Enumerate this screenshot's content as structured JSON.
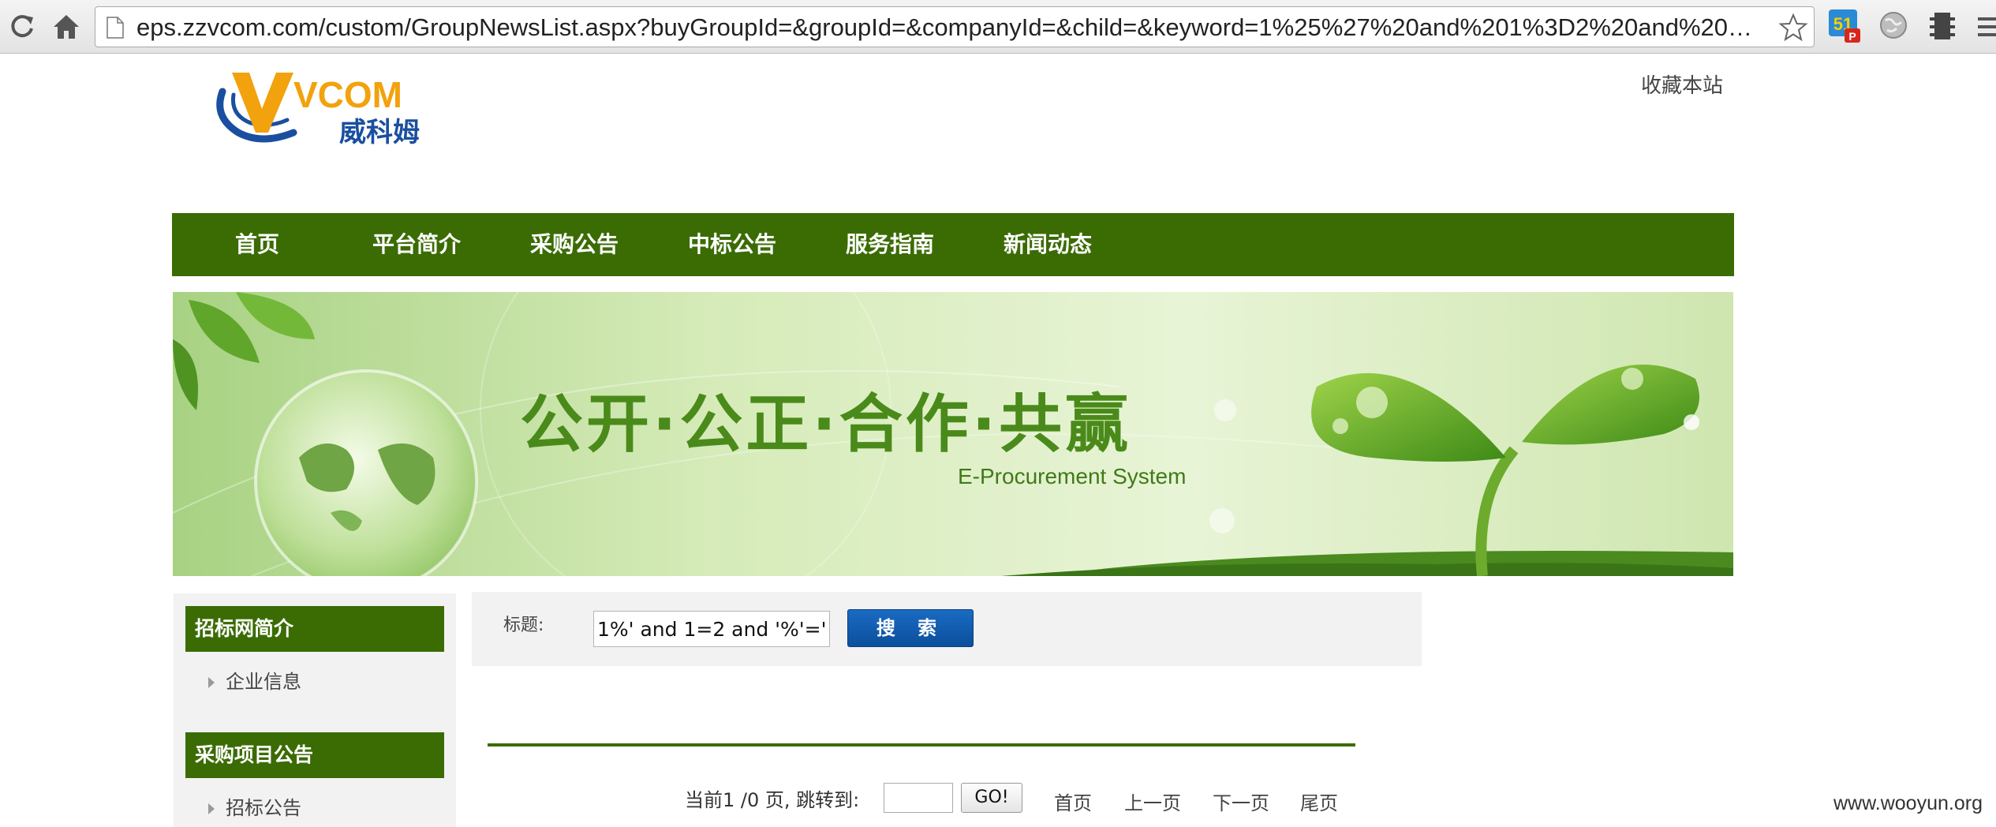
{
  "browser": {
    "url": "eps.zzvcom.com/custom/GroupNewsList.aspx?buyGroupId=&groupId=&companyId=&child=&keyword=1%25%27%20and%201%3D2%20and%20%27%25%27%3D%27",
    "extension_badge": "51",
    "extension_badge_sub": "P"
  },
  "header": {
    "logo_text": "VCOM",
    "logo_cn": "威科姆",
    "favorite_link": "收藏本站"
  },
  "nav": {
    "items": [
      "首页",
      "平台简介",
      "采购公告",
      "中标公告",
      "服务指南",
      "新闻动态"
    ]
  },
  "banner": {
    "slogan": "公开·公正·合作·共赢",
    "subtitle": "E-Procurement System"
  },
  "sidebar": {
    "sections": [
      {
        "title": "招标网简介",
        "links": [
          "企业信息"
        ]
      },
      {
        "title": "采购项目公告",
        "links": [
          "招标公告"
        ]
      }
    ]
  },
  "search": {
    "label": "标题:",
    "value": "1%' and 1=2 and '%'='",
    "button": "搜 索"
  },
  "pagination": {
    "status": "当前1 /0 页, 跳转到:",
    "go_button": "GO!",
    "first": "首页",
    "prev": "上一页",
    "next": "下一页",
    "last": "尾页"
  },
  "watermark": "www.wooyun.org",
  "colors": {
    "nav_green": "#3b6c04",
    "search_button_blue": "#0b4f9c",
    "panel_gray": "#f2f2f2"
  }
}
